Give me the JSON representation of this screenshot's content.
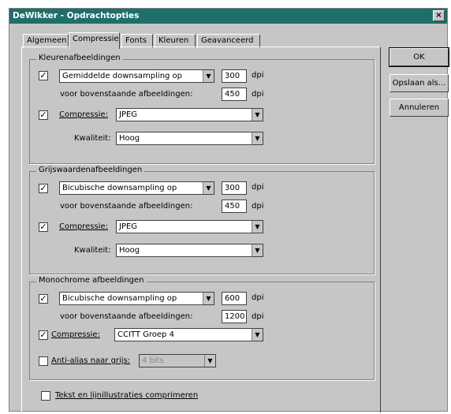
{
  "window": {
    "title": "DeWikker - Opdrachtopties",
    "close": "×"
  },
  "tabs": [
    "Algemeen",
    "Compressie",
    "Fonts",
    "Kleuren",
    "Geavanceerd"
  ],
  "color": {
    "title": "Kleurenafbeeldingen",
    "downsample_label": "Gemiddelde downsampling op",
    "dpi": "300",
    "above_label": "voor bovenstaande afbeeldingen:",
    "above_dpi": "450",
    "compression_label": "Compressie:",
    "compression_value": "JPEG",
    "quality_label": "Kwaliteit:",
    "quality_value": "Hoog"
  },
  "gray": {
    "title": "Grijswaardenafbeeldingen",
    "downsample_label": "Bicubische downsampling op",
    "dpi": "300",
    "above_label": "voor bovenstaande afbeeldingen:",
    "above_dpi": "450",
    "compression_label": "Compressie:",
    "compression_value": "JPEG",
    "quality_label": "Kwaliteit:",
    "quality_value": "Hoog"
  },
  "mono": {
    "title": "Monochrome afbeeldingen",
    "downsample_label": "Bicubische downsampling op",
    "dpi": "600",
    "above_label": "voor bovenstaande afbeeldingen:",
    "above_dpi": "1200",
    "compression_label": "Compressie:",
    "compression_value": "CCITT Groep 4",
    "antialias_label": "Anti-alias naar grijs:",
    "antialias_value": "4 bits"
  },
  "unit": "dpi",
  "check_mark": "✓",
  "compress_text_label": "Tekst en lijnillustraties comprimeren",
  "buttons": {
    "ok": "OK",
    "save_as": "Opslaan als...",
    "cancel": "Annuleren"
  },
  "arrow_glyph": "▼"
}
